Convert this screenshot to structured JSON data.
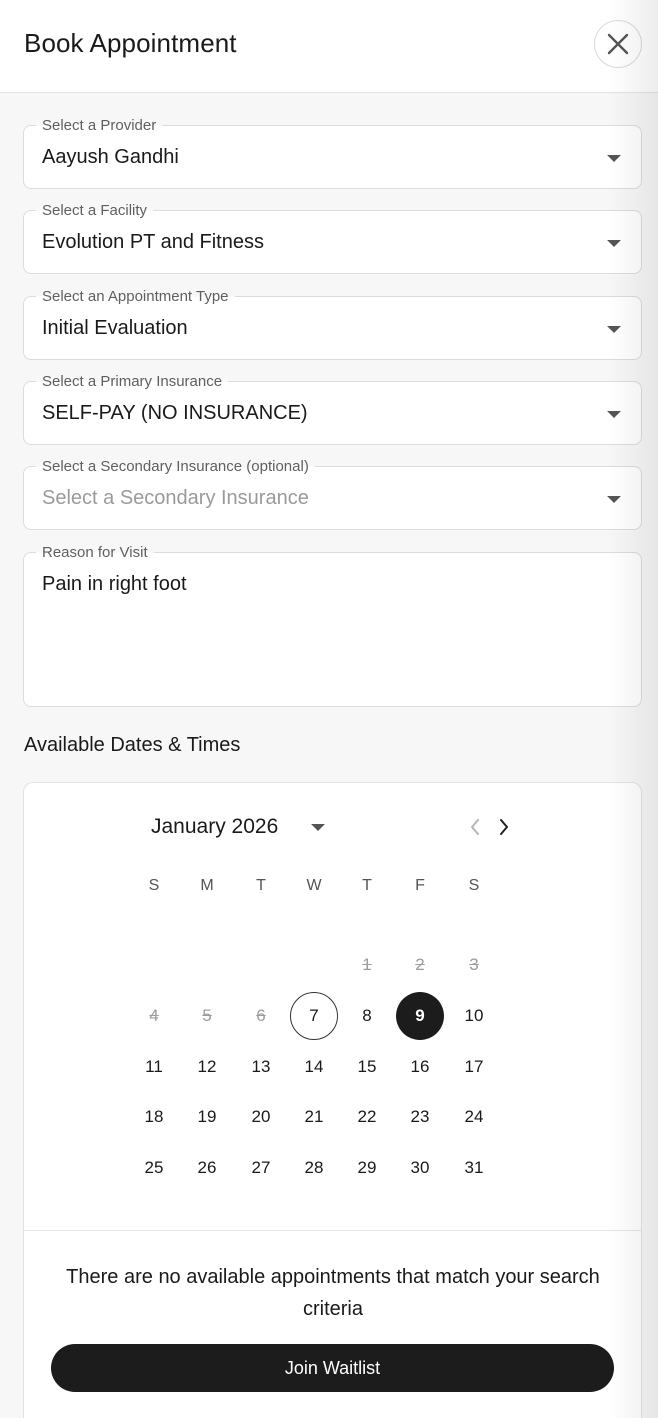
{
  "header": {
    "title": "Book Appointment",
    "close_icon": "close-icon"
  },
  "form": {
    "provider": {
      "label": "Select a Provider",
      "value": "Aayush Gandhi"
    },
    "facility": {
      "label": "Select a Facility",
      "value": "Evolution PT and Fitness"
    },
    "appointment_type": {
      "label": "Select an Appointment Type",
      "value": "Initial Evaluation"
    },
    "primary_insurance": {
      "label": "Select a Primary Insurance",
      "value": "SELF-PAY (NO INSURANCE)"
    },
    "secondary_insurance": {
      "label": "Select a Secondary Insurance (optional)",
      "placeholder": "Select a Secondary Insurance"
    },
    "reason": {
      "label": "Reason for Visit",
      "value": "Pain in right foot"
    }
  },
  "availability": {
    "title": "Available Dates & Times",
    "month_label": "January 2026",
    "weekdays": [
      "S",
      "M",
      "T",
      "W",
      "T",
      "F",
      "S"
    ],
    "days": [
      {
        "n": "1",
        "state": "disabled"
      },
      {
        "n": "2",
        "state": "disabled"
      },
      {
        "n": "3",
        "state": "disabled"
      },
      {
        "n": "4",
        "state": "disabled"
      },
      {
        "n": "5",
        "state": "disabled"
      },
      {
        "n": "6",
        "state": "disabled"
      },
      {
        "n": "7",
        "state": "today"
      },
      {
        "n": "8",
        "state": "normal"
      },
      {
        "n": "9",
        "state": "selected"
      },
      {
        "n": "10",
        "state": "normal"
      },
      {
        "n": "11",
        "state": "normal"
      },
      {
        "n": "12",
        "state": "normal"
      },
      {
        "n": "13",
        "state": "normal"
      },
      {
        "n": "14",
        "state": "normal"
      },
      {
        "n": "15",
        "state": "normal"
      },
      {
        "n": "16",
        "state": "normal"
      },
      {
        "n": "17",
        "state": "normal"
      },
      {
        "n": "18",
        "state": "normal"
      },
      {
        "n": "19",
        "state": "normal"
      },
      {
        "n": "20",
        "state": "normal"
      },
      {
        "n": "21",
        "state": "normal"
      },
      {
        "n": "22",
        "state": "normal"
      },
      {
        "n": "23",
        "state": "normal"
      },
      {
        "n": "24",
        "state": "normal"
      },
      {
        "n": "25",
        "state": "normal"
      },
      {
        "n": "26",
        "state": "normal"
      },
      {
        "n": "27",
        "state": "normal"
      },
      {
        "n": "28",
        "state": "normal"
      },
      {
        "n": "29",
        "state": "normal"
      },
      {
        "n": "30",
        "state": "normal"
      },
      {
        "n": "31",
        "state": "normal"
      }
    ],
    "no_results_text": "There are no available appointments that match your search criteria",
    "waitlist_button": "Join Waitlist"
  },
  "colors": {
    "selected_day": "#1c1c1c",
    "button_bg": "#1c1c1c",
    "disabled_day": "#9c9c9c"
  }
}
